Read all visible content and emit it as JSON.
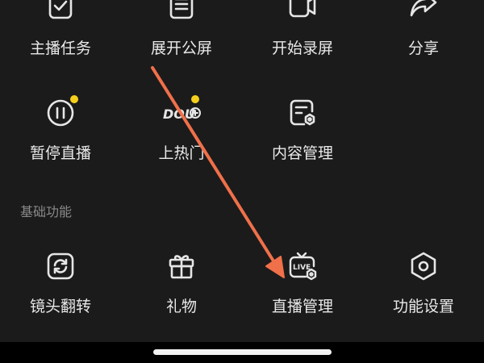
{
  "row1": [
    {
      "label": "主播任务",
      "icon": "task-check-icon"
    },
    {
      "label": "展开公屏",
      "icon": "list-doc-icon"
    },
    {
      "label": "开始录屏",
      "icon": "record-camera-icon"
    },
    {
      "label": "分享",
      "icon": "share-arrow-icon"
    }
  ],
  "row2": [
    {
      "label": "暂停直播",
      "icon": "pause-icon",
      "badge": true
    },
    {
      "label": "上热门",
      "icon": "doujia-icon",
      "icon_text": "DOU",
      "badge": true
    },
    {
      "label": "内容管理",
      "icon": "content-settings-icon"
    }
  ],
  "section": {
    "title": "基础功能"
  },
  "row3": [
    {
      "label": "镜头翻转",
      "icon": "camera-flip-icon"
    },
    {
      "label": "礼物",
      "icon": "gift-icon"
    },
    {
      "label": "直播管理",
      "icon": "live-tv-settings-icon",
      "icon_text": "LIVE"
    },
    {
      "label": "功能设置",
      "icon": "hexagon-settings-icon"
    }
  ],
  "colors": {
    "background": "#1b1b1b",
    "label": "#e9e9e9",
    "section": "#8a8a8a",
    "badge": "#f6cf1d",
    "annotation_arrow": "#f0704a"
  }
}
